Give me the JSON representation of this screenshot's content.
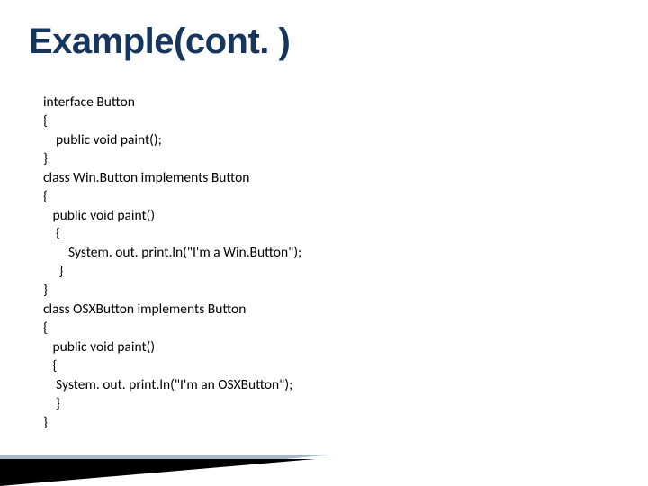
{
  "title": "Example(cont. )",
  "code": {
    "l1": "interface Button",
    "l2": "{",
    "l3": "    public void paint();",
    "l4": "}",
    "l5": "class Win.Button implements Button",
    "l6": "{",
    "l7": "   public void paint()",
    "l8": "    {",
    "l9": "        System. out. print.ln(\"I'm a Win.Button\");",
    "l10": "     }",
    "l11": "}",
    "l12": "class OSXButton implements Button",
    "l13": "{",
    "l14": "   public void paint()",
    "l15": "   {",
    "l16": "    System. out. print.ln(\"I'm an OSXButton\");",
    "l17": "    }",
    "l18": "}"
  }
}
